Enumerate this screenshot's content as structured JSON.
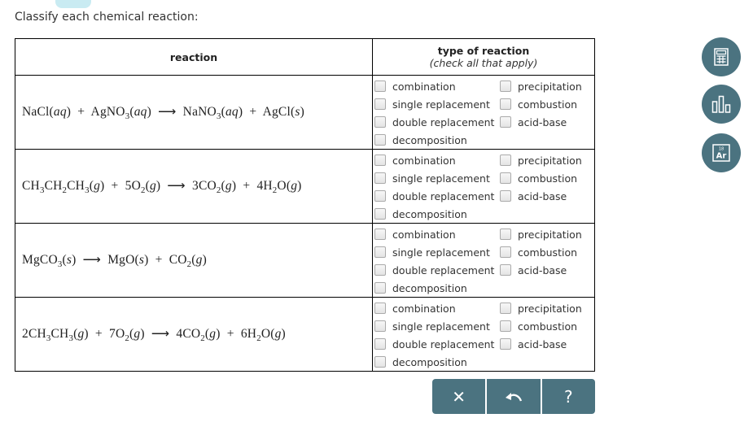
{
  "instruction": "Classify each chemical reaction:",
  "table": {
    "header_reaction": "reaction",
    "header_type": "type of reaction",
    "header_type_sub": "(check all that apply)",
    "options_left": [
      "combination",
      "single replacement",
      "double replacement",
      "decomposition"
    ],
    "options_right": [
      "precipitation",
      "combustion",
      "acid-base"
    ],
    "rows": [
      {
        "equation": "NaCl(aq) + AgNO3(aq) → NaNO3(aq) + AgCl(s)",
        "checked": {
          "combination": false,
          "single replacement": false,
          "double replacement": false,
          "decomposition": false,
          "precipitation": false,
          "combustion": false,
          "acid-base": false
        }
      },
      {
        "equation": "CH3CH2CH3(g) + 5O2(g) → 3CO2(g) + 4H2O(g)",
        "checked": {
          "combination": false,
          "single replacement": false,
          "double replacement": false,
          "decomposition": false,
          "precipitation": false,
          "combustion": false,
          "acid-base": false
        }
      },
      {
        "equation": "MgCO3(s) → MgO(s) + CO2(g)",
        "checked": {
          "combination": false,
          "single replacement": false,
          "double replacement": false,
          "decomposition": false,
          "precipitation": false,
          "combustion": false,
          "acid-base": false
        }
      },
      {
        "equation": "2CH3CH3(g) + 7O2(g) → 4CO2(g) + 6H2O(g)",
        "checked": {
          "combination": false,
          "single replacement": false,
          "double replacement": false,
          "decomposition": false,
          "precipitation": false,
          "combustion": false,
          "acid-base": false
        }
      }
    ]
  },
  "buttons": {
    "clear": "✕",
    "undo": "↶",
    "help": "?"
  },
  "side_tools": [
    {
      "name": "calculator",
      "icon": "calculator-icon"
    },
    {
      "name": "data",
      "icon": "bar-chart-icon"
    },
    {
      "name": "periodic table",
      "icon": "periodic-table-icon",
      "element_number": "18",
      "element_symbol": "Ar"
    }
  ],
  "colors": {
    "accent": "#4b7380",
    "tab": "#c9ebf2"
  }
}
